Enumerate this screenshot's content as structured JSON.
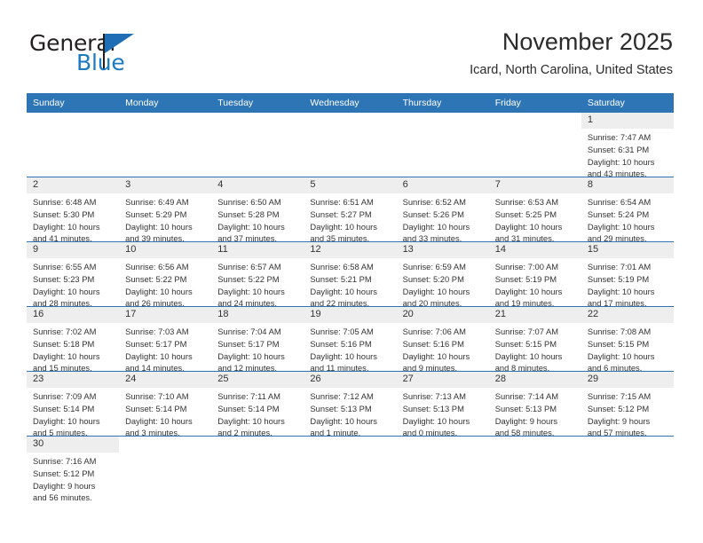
{
  "brand": {
    "name_part1": "General",
    "name_part2": "Blue",
    "logo_icon": "triangle-flag-icon"
  },
  "header": {
    "title": "November 2025",
    "location": "Icard, North Carolina, United States"
  },
  "weekday_headers": [
    "Sunday",
    "Monday",
    "Tuesday",
    "Wednesday",
    "Thursday",
    "Friday",
    "Saturday"
  ],
  "colors": {
    "header_blue": "#2e75b6",
    "brand_blue": "#1a7bc4",
    "daynum_bg": "#eeeeee",
    "text": "#333333"
  },
  "weeks": [
    [
      {
        "blank": true,
        "day": "",
        "sunrise": "",
        "sunset": "",
        "daylight_line1": "",
        "daylight_line2": ""
      },
      {
        "blank": true,
        "day": "",
        "sunrise": "",
        "sunset": "",
        "daylight_line1": "",
        "daylight_line2": ""
      },
      {
        "blank": true,
        "day": "",
        "sunrise": "",
        "sunset": "",
        "daylight_line1": "",
        "daylight_line2": ""
      },
      {
        "blank": true,
        "day": "",
        "sunrise": "",
        "sunset": "",
        "daylight_line1": "",
        "daylight_line2": ""
      },
      {
        "blank": true,
        "day": "",
        "sunrise": "",
        "sunset": "",
        "daylight_line1": "",
        "daylight_line2": ""
      },
      {
        "blank": true,
        "day": "",
        "sunrise": "",
        "sunset": "",
        "daylight_line1": "",
        "daylight_line2": ""
      },
      {
        "blank": false,
        "day": "1",
        "sunrise": "Sunrise: 7:47 AM",
        "sunset": "Sunset: 6:31 PM",
        "daylight_line1": "Daylight: 10 hours",
        "daylight_line2": "and 43 minutes."
      }
    ],
    [
      {
        "blank": false,
        "day": "2",
        "sunrise": "Sunrise: 6:48 AM",
        "sunset": "Sunset: 5:30 PM",
        "daylight_line1": "Daylight: 10 hours",
        "daylight_line2": "and 41 minutes."
      },
      {
        "blank": false,
        "day": "3",
        "sunrise": "Sunrise: 6:49 AM",
        "sunset": "Sunset: 5:29 PM",
        "daylight_line1": "Daylight: 10 hours",
        "daylight_line2": "and 39 minutes."
      },
      {
        "blank": false,
        "day": "4",
        "sunrise": "Sunrise: 6:50 AM",
        "sunset": "Sunset: 5:28 PM",
        "daylight_line1": "Daylight: 10 hours",
        "daylight_line2": "and 37 minutes."
      },
      {
        "blank": false,
        "day": "5",
        "sunrise": "Sunrise: 6:51 AM",
        "sunset": "Sunset: 5:27 PM",
        "daylight_line1": "Daylight: 10 hours",
        "daylight_line2": "and 35 minutes."
      },
      {
        "blank": false,
        "day": "6",
        "sunrise": "Sunrise: 6:52 AM",
        "sunset": "Sunset: 5:26 PM",
        "daylight_line1": "Daylight: 10 hours",
        "daylight_line2": "and 33 minutes."
      },
      {
        "blank": false,
        "day": "7",
        "sunrise": "Sunrise: 6:53 AM",
        "sunset": "Sunset: 5:25 PM",
        "daylight_line1": "Daylight: 10 hours",
        "daylight_line2": "and 31 minutes."
      },
      {
        "blank": false,
        "day": "8",
        "sunrise": "Sunrise: 6:54 AM",
        "sunset": "Sunset: 5:24 PM",
        "daylight_line1": "Daylight: 10 hours",
        "daylight_line2": "and 29 minutes."
      }
    ],
    [
      {
        "blank": false,
        "day": "9",
        "sunrise": "Sunrise: 6:55 AM",
        "sunset": "Sunset: 5:23 PM",
        "daylight_line1": "Daylight: 10 hours",
        "daylight_line2": "and 28 minutes."
      },
      {
        "blank": false,
        "day": "10",
        "sunrise": "Sunrise: 6:56 AM",
        "sunset": "Sunset: 5:22 PM",
        "daylight_line1": "Daylight: 10 hours",
        "daylight_line2": "and 26 minutes."
      },
      {
        "blank": false,
        "day": "11",
        "sunrise": "Sunrise: 6:57 AM",
        "sunset": "Sunset: 5:22 PM",
        "daylight_line1": "Daylight: 10 hours",
        "daylight_line2": "and 24 minutes."
      },
      {
        "blank": false,
        "day": "12",
        "sunrise": "Sunrise: 6:58 AM",
        "sunset": "Sunset: 5:21 PM",
        "daylight_line1": "Daylight: 10 hours",
        "daylight_line2": "and 22 minutes."
      },
      {
        "blank": false,
        "day": "13",
        "sunrise": "Sunrise: 6:59 AM",
        "sunset": "Sunset: 5:20 PM",
        "daylight_line1": "Daylight: 10 hours",
        "daylight_line2": "and 20 minutes."
      },
      {
        "blank": false,
        "day": "14",
        "sunrise": "Sunrise: 7:00 AM",
        "sunset": "Sunset: 5:19 PM",
        "daylight_line1": "Daylight: 10 hours",
        "daylight_line2": "and 19 minutes."
      },
      {
        "blank": false,
        "day": "15",
        "sunrise": "Sunrise: 7:01 AM",
        "sunset": "Sunset: 5:19 PM",
        "daylight_line1": "Daylight: 10 hours",
        "daylight_line2": "and 17 minutes."
      }
    ],
    [
      {
        "blank": false,
        "day": "16",
        "sunrise": "Sunrise: 7:02 AM",
        "sunset": "Sunset: 5:18 PM",
        "daylight_line1": "Daylight: 10 hours",
        "daylight_line2": "and 15 minutes."
      },
      {
        "blank": false,
        "day": "17",
        "sunrise": "Sunrise: 7:03 AM",
        "sunset": "Sunset: 5:17 PM",
        "daylight_line1": "Daylight: 10 hours",
        "daylight_line2": "and 14 minutes."
      },
      {
        "blank": false,
        "day": "18",
        "sunrise": "Sunrise: 7:04 AM",
        "sunset": "Sunset: 5:17 PM",
        "daylight_line1": "Daylight: 10 hours",
        "daylight_line2": "and 12 minutes."
      },
      {
        "blank": false,
        "day": "19",
        "sunrise": "Sunrise: 7:05 AM",
        "sunset": "Sunset: 5:16 PM",
        "daylight_line1": "Daylight: 10 hours",
        "daylight_line2": "and 11 minutes."
      },
      {
        "blank": false,
        "day": "20",
        "sunrise": "Sunrise: 7:06 AM",
        "sunset": "Sunset: 5:16 PM",
        "daylight_line1": "Daylight: 10 hours",
        "daylight_line2": "and 9 minutes."
      },
      {
        "blank": false,
        "day": "21",
        "sunrise": "Sunrise: 7:07 AM",
        "sunset": "Sunset: 5:15 PM",
        "daylight_line1": "Daylight: 10 hours",
        "daylight_line2": "and 8 minutes."
      },
      {
        "blank": false,
        "day": "22",
        "sunrise": "Sunrise: 7:08 AM",
        "sunset": "Sunset: 5:15 PM",
        "daylight_line1": "Daylight: 10 hours",
        "daylight_line2": "and 6 minutes."
      }
    ],
    [
      {
        "blank": false,
        "day": "23",
        "sunrise": "Sunrise: 7:09 AM",
        "sunset": "Sunset: 5:14 PM",
        "daylight_line1": "Daylight: 10 hours",
        "daylight_line2": "and 5 minutes."
      },
      {
        "blank": false,
        "day": "24",
        "sunrise": "Sunrise: 7:10 AM",
        "sunset": "Sunset: 5:14 PM",
        "daylight_line1": "Daylight: 10 hours",
        "daylight_line2": "and 3 minutes."
      },
      {
        "blank": false,
        "day": "25",
        "sunrise": "Sunrise: 7:11 AM",
        "sunset": "Sunset: 5:14 PM",
        "daylight_line1": "Daylight: 10 hours",
        "daylight_line2": "and 2 minutes."
      },
      {
        "blank": false,
        "day": "26",
        "sunrise": "Sunrise: 7:12 AM",
        "sunset": "Sunset: 5:13 PM",
        "daylight_line1": "Daylight: 10 hours",
        "daylight_line2": "and 1 minute."
      },
      {
        "blank": false,
        "day": "27",
        "sunrise": "Sunrise: 7:13 AM",
        "sunset": "Sunset: 5:13 PM",
        "daylight_line1": "Daylight: 10 hours",
        "daylight_line2": "and 0 minutes."
      },
      {
        "blank": false,
        "day": "28",
        "sunrise": "Sunrise: 7:14 AM",
        "sunset": "Sunset: 5:13 PM",
        "daylight_line1": "Daylight: 9 hours",
        "daylight_line2": "and 58 minutes."
      },
      {
        "blank": false,
        "day": "29",
        "sunrise": "Sunrise: 7:15 AM",
        "sunset": "Sunset: 5:12 PM",
        "daylight_line1": "Daylight: 9 hours",
        "daylight_line2": "and 57 minutes."
      }
    ],
    [
      {
        "blank": false,
        "day": "30",
        "sunrise": "Sunrise: 7:16 AM",
        "sunset": "Sunset: 5:12 PM",
        "daylight_line1": "Daylight: 9 hours",
        "daylight_line2": "and 56 minutes."
      },
      {
        "blank": true,
        "day": "",
        "sunrise": "",
        "sunset": "",
        "daylight_line1": "",
        "daylight_line2": ""
      },
      {
        "blank": true,
        "day": "",
        "sunrise": "",
        "sunset": "",
        "daylight_line1": "",
        "daylight_line2": ""
      },
      {
        "blank": true,
        "day": "",
        "sunrise": "",
        "sunset": "",
        "daylight_line1": "",
        "daylight_line2": ""
      },
      {
        "blank": true,
        "day": "",
        "sunrise": "",
        "sunset": "",
        "daylight_line1": "",
        "daylight_line2": ""
      },
      {
        "blank": true,
        "day": "",
        "sunrise": "",
        "sunset": "",
        "daylight_line1": "",
        "daylight_line2": ""
      },
      {
        "blank": true,
        "day": "",
        "sunrise": "",
        "sunset": "",
        "daylight_line1": "",
        "daylight_line2": ""
      }
    ]
  ]
}
